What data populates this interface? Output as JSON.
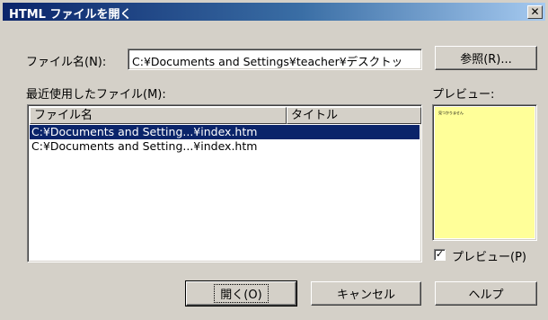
{
  "window": {
    "title": "HTML ファイルを開く",
    "close_glyph": "✕"
  },
  "filename": {
    "label": "ファイル名(N):",
    "value": "C:¥Documents and Settings¥teacher¥デスクトッ"
  },
  "browse_button": {
    "label": "参照(R)..."
  },
  "recent": {
    "label": "最近使用したファイル(M):",
    "columns": [
      "ファイル名",
      "タイトル"
    ],
    "rows": [
      {
        "file": "C:¥Documents and Setting...¥index.htm",
        "title": "",
        "selected": true
      },
      {
        "file": "C:¥Documents and Setting...¥index.htm",
        "title": "",
        "selected": false
      }
    ]
  },
  "preview": {
    "label": "プレビュー:",
    "thumbnail_text": "見つかりません",
    "background": "#ffff99",
    "checkbox_label": "プレビュー(P)",
    "checkbox_checked": true,
    "check_glyph": "✓"
  },
  "buttons": {
    "open": "開く(O)",
    "cancel": "キャンセル",
    "help": "ヘルプ"
  }
}
